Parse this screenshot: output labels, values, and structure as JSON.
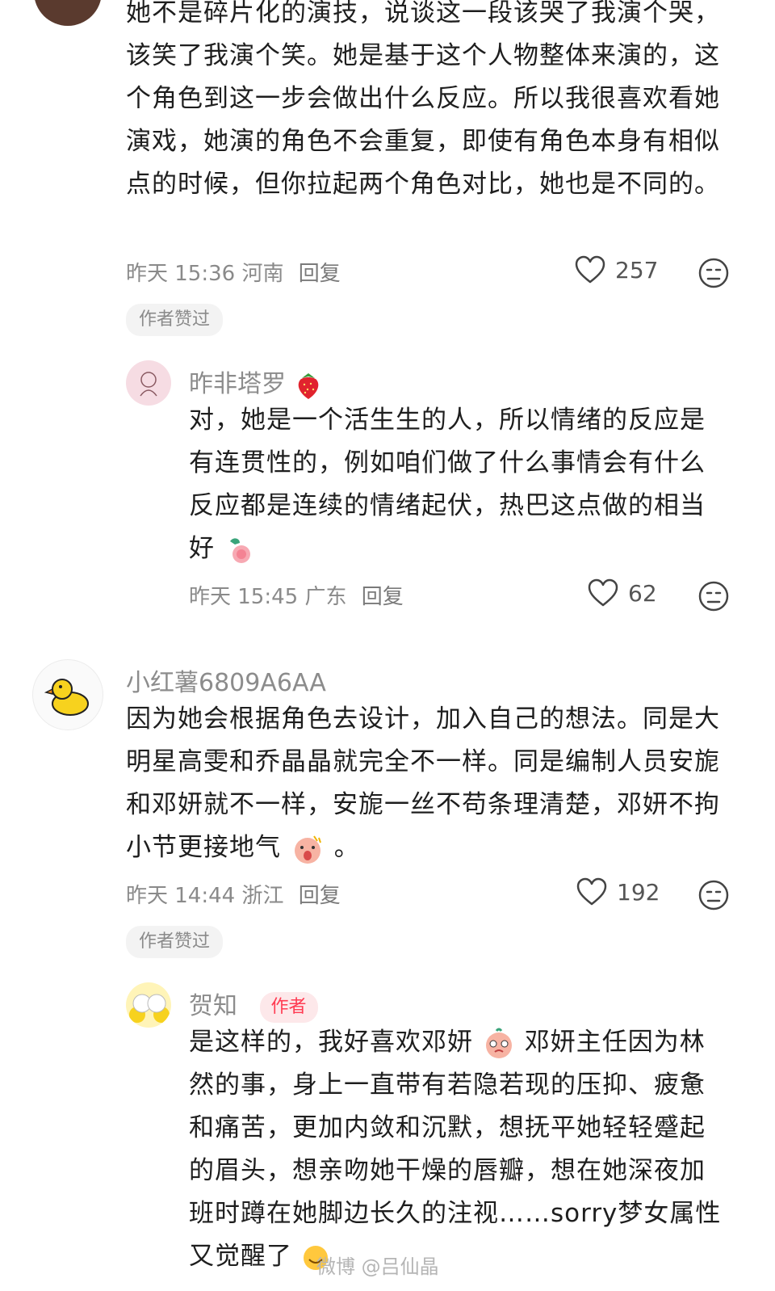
{
  "comments": [
    {
      "text": "她不是碎片化的演技，说谈这一段该哭了我演个哭，该笑了我演个笑。她是基于这个人物整体来演的，这个角色到这一步会做出什么反应。所以我很喜欢看她演戏，她演的角色不会重复，即使有角色本身有相似点的时候，但你拉起两个角色对比，她也是不同的。",
      "time": "昨天 15:36",
      "location": "河南",
      "reply_label": "回复",
      "likes": "257",
      "badge": "作者赞过",
      "reply": {
        "name": "昨非塔罗",
        "text": "对，她是一个活生生的人，所以情绪的反应是有连贯性的，例如咱们做了什么事情会有什么反应都是连续的情绪起伏，热巴这点做的相当好",
        "time": "昨天 15:45",
        "location": "广东",
        "reply_label": "回复",
        "likes": "62"
      }
    },
    {
      "name": "小红薯6809A6AA",
      "text": "因为她会根据角色去设计，加入自己的想法。同是大明星高雯和乔晶晶就完全不一样。同是编制人员安旎和邓妍就不一样，安旎一丝不苟条理清楚，邓妍不拘小节更接地气",
      "text_end": "。",
      "time": "昨天 14:44",
      "location": "浙江",
      "reply_label": "回复",
      "likes": "192",
      "badge": "作者赞过",
      "reply": {
        "name": "贺知",
        "author_tag": "作者",
        "text_a": "是这样的，我好喜欢邓妍",
        "text_b": "邓妍主任因为林然的事，身上一直带有若隐若现的压抑、疲惫和痛苦，更加内敛和沉默，想抚平她轻轻蹙起的眉头，想亲吻她干燥的唇瓣，想在她深夜加班时蹲在她脚边长久的注视……sorry梦女属性又觉醒了"
      }
    }
  ],
  "watermark": "微博 @吕仙晶",
  "colors": {
    "author_red": "#ff3b52",
    "badge_bg": "#f3f3f3",
    "meta_gray": "#8a8a8a"
  }
}
